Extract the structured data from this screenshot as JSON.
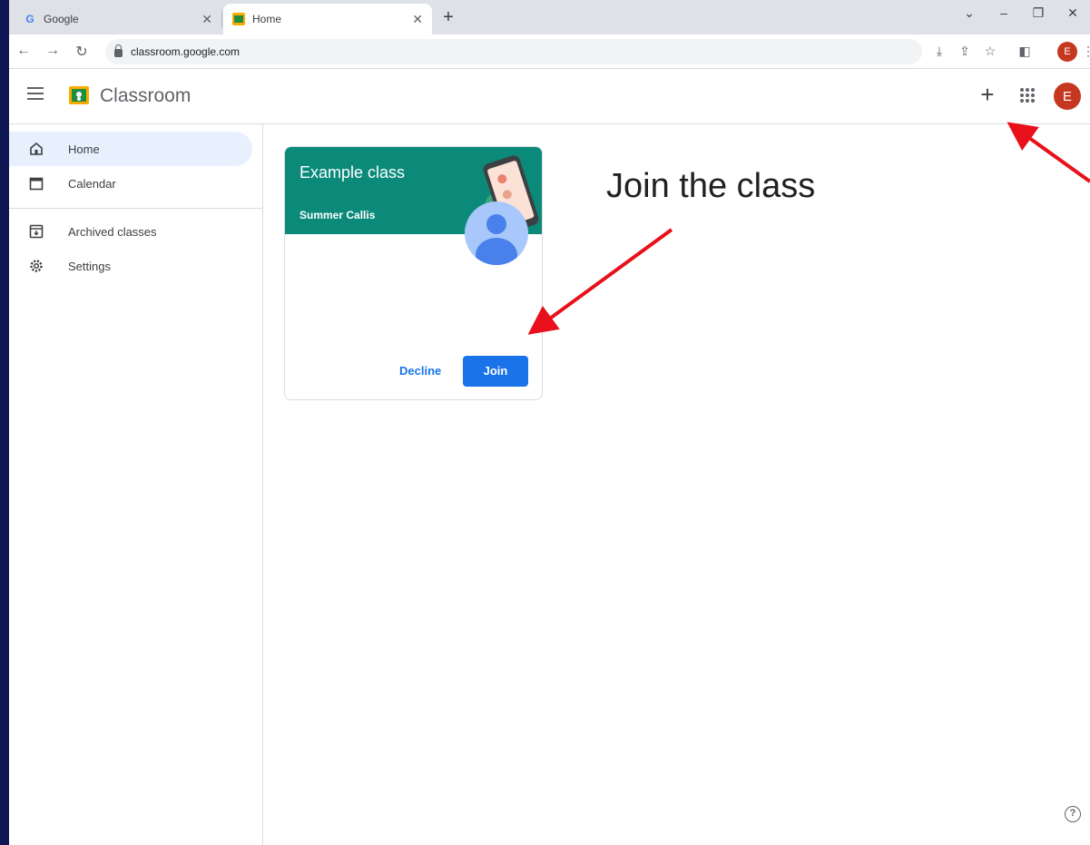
{
  "browser": {
    "tabs": [
      {
        "title": "Google",
        "favicon": "google-g-icon"
      },
      {
        "title": "Home",
        "favicon": "classroom-icon",
        "active": true
      }
    ],
    "new_tab": "+",
    "url": "classroom.google.com",
    "profile_initial": "E"
  },
  "header": {
    "app_title": "Classroom",
    "create_label": "+",
    "avatar_initial": "E"
  },
  "sidebar": {
    "items": [
      {
        "label": "Home",
        "icon": "home-icon",
        "active": true
      },
      {
        "label": "Calendar",
        "icon": "calendar-icon"
      },
      {
        "label": "Archived classes",
        "icon": "archive-icon"
      },
      {
        "label": "Settings",
        "icon": "gear-icon"
      }
    ]
  },
  "card": {
    "title": "Example class",
    "teacher": "Summer Callis",
    "decline_label": "Decline",
    "join_label": "Join"
  },
  "annotation": {
    "text": "Join the class",
    "arrow_color": "#e8101a"
  },
  "colors": {
    "card_header": "#0b8a7a",
    "accent": "#1a73e8",
    "avatar": "#c5381f"
  }
}
